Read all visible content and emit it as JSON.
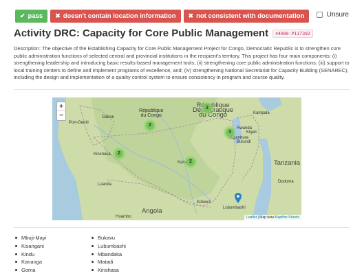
{
  "buttons": {
    "pass": "pass",
    "no_location": "doesn't contain location information",
    "not_consistent": "not consistent with documentation"
  },
  "unsure_label": "Unsure",
  "activity": {
    "title": "Activity DRC: Capacity for Core Public Management",
    "project_code": "44000-P117382",
    "description": "Description: The objective of the Establishing Capacity for Core Public Management Project for Congo, Democratic Republic is to strengthen core public administration functions of selected central and provincial institutions in the recipient's territory. This project has four main components: (i) strengthening leadership and introducing basic results-based management tools; (ii) strengthening core public administration functions; (iii) support to local training centers to define and implement programs of excellence, and; (iv) strengthening National Secretariat for Capacity Building (SENAREC), including the design and implementation of a quality control system to ensure consistency in program and course quality."
  },
  "map": {
    "zoom_in": "+",
    "zoom_out": "−",
    "labels": {
      "gabon": "Gabon",
      "rep_congo_1": "République",
      "rep_congo_2": "du Congo",
      "drc_1": "République",
      "drc_2": "Démocratique",
      "drc_3": "du Congo",
      "angola": "Angola",
      "tanzania": "Tanzania",
      "rwanda": "Rwanda",
      "burundi": "Burundi",
      "port_gentil": "Port-Gentil",
      "kinshasa": "Kinshasa",
      "kananga": "Kananga",
      "luanda": "Luanda",
      "huambo": "Huambo",
      "kolwezi": "Kolwezi",
      "lubumbashi": "Lubumbashi",
      "dodoma": "Dodoma",
      "kampala": "Kampala",
      "kigali": "Kigali",
      "bujumbura": "Bujumbura"
    },
    "clusters": [
      "2",
      "2",
      "2",
      "3",
      "2"
    ],
    "attribution_leaflet": "Leaflet",
    "attribution_sep": " | Map data ",
    "attribution_data": "MapBox Streets"
  },
  "locations": {
    "column1": [
      "Mbuji-Mayi",
      "Kisangani",
      "Kindu",
      "Kananga",
      "Goma"
    ],
    "column2": [
      "Bukavu",
      "Lubumbashi",
      "Mbandaka",
      "Matadi",
      "Kinshasa"
    ]
  },
  "colors": {
    "pass": "#5cb85c",
    "reject": "#d9534f",
    "cluster": "#78c55a",
    "pin": "#2a7fc9"
  }
}
